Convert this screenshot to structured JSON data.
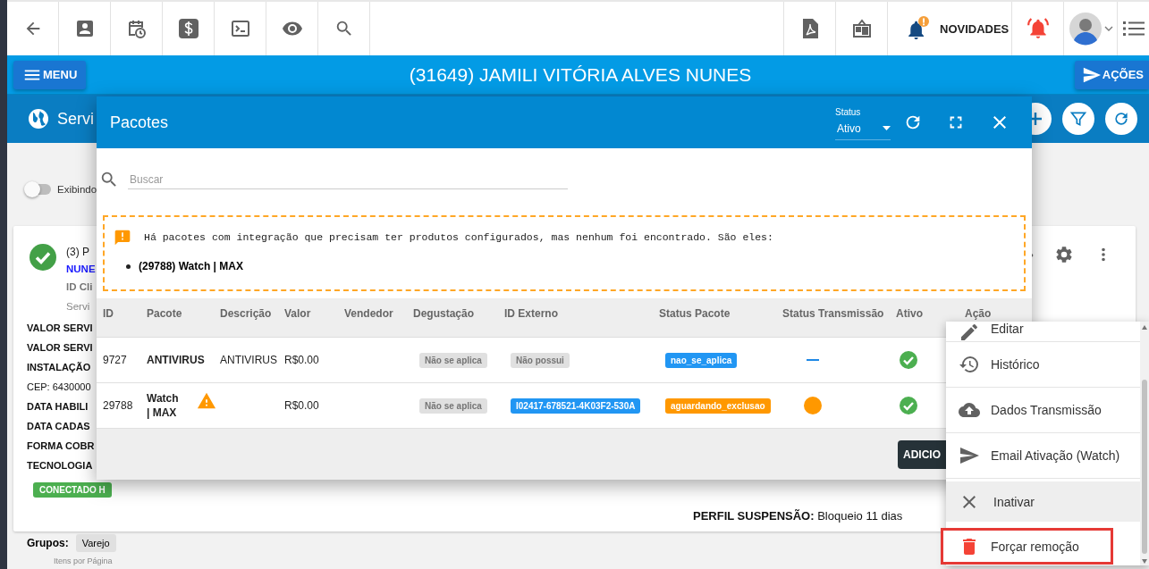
{
  "toolbar": {
    "news_label": "NOVIDADES"
  },
  "header": {
    "menu_label": "MENU",
    "title": "(31649) JAMILI VITÓRIA ALVES NUNES",
    "actions_label": "AÇÕES"
  },
  "section": {
    "title": "Servi"
  },
  "filter_toggle": {
    "label": "Exibindo",
    "on": false
  },
  "card": {
    "title": "(3) P",
    "subtitle": "NUNE",
    "client_id": "ID Cli",
    "service": "Servi",
    "details": [
      {
        "text": "VALOR SERVI",
        "bold": true
      },
      {
        "text": "VALOR SERVI",
        "bold": true
      },
      {
        "text": "INSTALAÇÃO",
        "bold": true
      },
      {
        "text": "CEP: 6430000",
        "bold": false
      },
      {
        "text": "DATA HABILI",
        "bold": true
      },
      {
        "text": "DATA CADAS",
        "bold": true
      },
      {
        "text": "FORMA COBR",
        "bold": true
      },
      {
        "text": "TECNOLOGIA",
        "bold": true
      }
    ],
    "status_badge": "CONECTADO H",
    "suspension": {
      "label": "PERFIL SUSPENSÃO:",
      "value": "Bloqueio 11 dias"
    },
    "groups_label": "Grupos:",
    "groups": [
      "Varejo"
    ]
  },
  "pagination": {
    "label": "Itens por Página"
  },
  "modal": {
    "title": "Pacotes",
    "status_filter": {
      "label": "Status",
      "value": "Ativo"
    },
    "search": {
      "placeholder": "Buscar"
    },
    "alert": {
      "message": "Há pacotes com integração que precisam ter produtos configurados, mas nenhum foi encontrado. São eles:",
      "items": [
        "(29788) Watch | MAX"
      ]
    },
    "table": {
      "columns": [
        "ID",
        "Pacote",
        "Descrição",
        "Valor",
        "Vendedor",
        "Degustação",
        "ID Externo",
        "Status Pacote",
        "Status Transmissão",
        "Ativo",
        "Ação"
      ],
      "rows": [
        {
          "id": "9727",
          "package": "ANTIVIRUS",
          "warning": false,
          "description": "ANTIVIRUS",
          "value": "R$0.00",
          "tasting": {
            "text": "Não se aplica",
            "color": "#e0e0e0"
          },
          "external_id": {
            "text": "Não possui",
            "color": "#e0e0e0"
          },
          "status": {
            "text": "nao_se_aplica",
            "color": "#2196f3"
          },
          "transmission": {
            "kind": "none"
          },
          "active": true
        },
        {
          "id": "29788",
          "package": "Watch | MAX",
          "warning": true,
          "value": "R$0.00",
          "tasting": {
            "text": "Não se aplica",
            "color": "#e0e0e0"
          },
          "external_id": {
            "text": "I02417-678521-4K03F2-530A",
            "color": "#2196f3"
          },
          "status": {
            "text": "aguardando_exclusao",
            "color": "#ff9800"
          },
          "transmission": {
            "kind": "pending"
          },
          "active": true
        }
      ]
    },
    "add_button": "ADICIO"
  },
  "menu": {
    "items": [
      {
        "kind": "edit",
        "label": "Editar",
        "highlighted": false,
        "outlined": false
      },
      {
        "kind": "history",
        "label": "Histórico",
        "highlighted": false,
        "outlined": false
      },
      {
        "kind": "upload",
        "label": "Dados Transmissão",
        "highlighted": false,
        "outlined": false
      },
      {
        "kind": "send",
        "label": "Email Ativação (Watch)",
        "highlighted": false,
        "outlined": false
      },
      {
        "kind": "deactivate",
        "label": "Inativar",
        "highlighted": true,
        "outlined": false
      },
      {
        "kind": "remove",
        "label": "Forçar remoção",
        "highlighted": false,
        "outlined": true
      }
    ]
  }
}
